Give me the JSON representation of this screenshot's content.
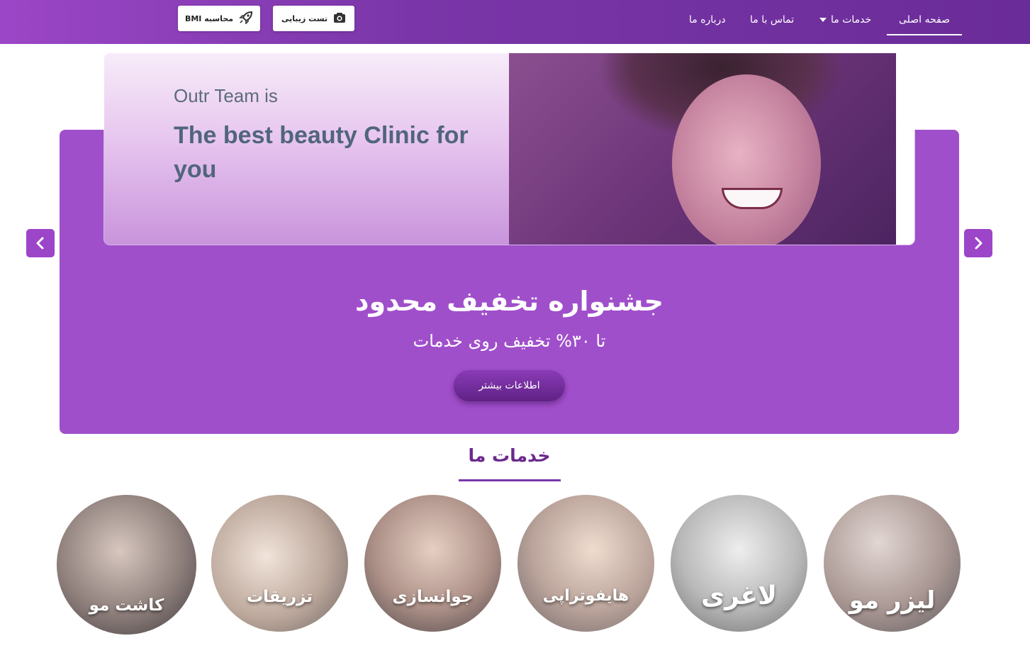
{
  "nav": {
    "items": [
      {
        "label": "صفحه اصلی",
        "active": true
      },
      {
        "label": "خدمات ما",
        "has_dropdown": true
      },
      {
        "label": "تماس با ما"
      },
      {
        "label": "درباره ما"
      }
    ],
    "beauty_test_label": "تست زیبایی",
    "bmi_label": "محاسبه BMI",
    "beauty_test_icon": "camera-icon",
    "bmi_icon": "rocket-icon"
  },
  "banner": {
    "line1": "Outr Team is",
    "line2": "The best beauty Clinic for you"
  },
  "hero": {
    "title": "جشنواره تخفیف محدود",
    "subtitle": "تا ۳۰% تخفیف روی خدمات",
    "button_label": "اطلاعات بیشتر",
    "prev_icon": "chevron-left-icon",
    "next_icon": "chevron-right-icon"
  },
  "services": {
    "title": "خدمات ما",
    "items": [
      {
        "label": "لیزر مو"
      },
      {
        "label": "لاغری"
      },
      {
        "label": "هایفوتراپی"
      },
      {
        "label": "جوانسازی"
      },
      {
        "label": "تزریقات"
      },
      {
        "label": "کاشت مو"
      }
    ]
  },
  "colors": {
    "brand_purple": "#a04fcb",
    "nav_gradient_start": "#9b46c6",
    "nav_gradient_end": "#6a2c98",
    "heading_purple": "#6b2a8e"
  }
}
